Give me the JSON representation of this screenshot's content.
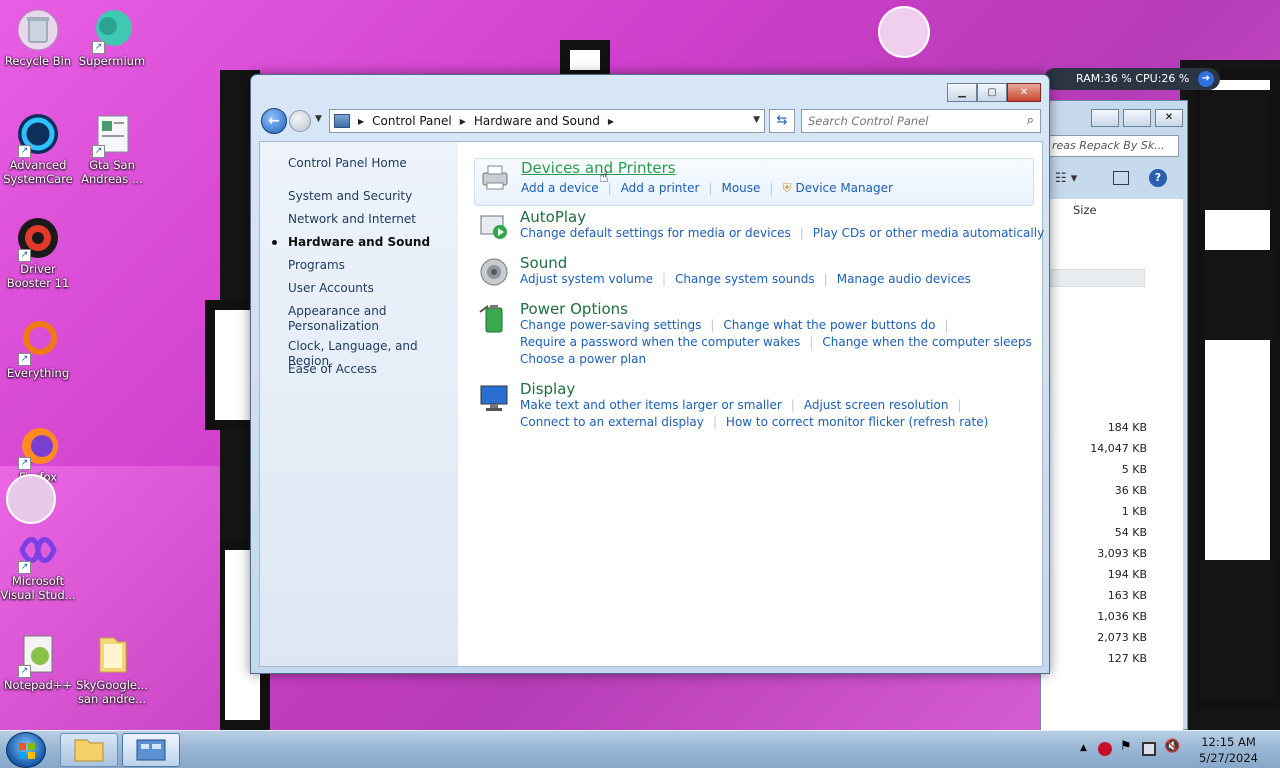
{
  "desktop": {
    "icons": [
      {
        "label": "Recycle Bin"
      },
      {
        "label": "Supermium"
      },
      {
        "label": "Advanced SystemCare"
      },
      {
        "label": "Gta San Andreas ..."
      },
      {
        "label": "Driver Booster 11"
      },
      {
        "label": "Everything"
      },
      {
        "label": "Firefox"
      },
      {
        "label": "Microsoft Visual Stud..."
      },
      {
        "label": "Notepad++"
      },
      {
        "label": "SkyGoogle... san andre..."
      }
    ]
  },
  "sysmon": {
    "text": "RAM:36 %  CPU:26 %"
  },
  "bg_window": {
    "search_placeholder": "reas Repack By Sk...",
    "column_size": "Size",
    "sizes": [
      "184 KB",
      "14,047 KB",
      "5 KB",
      "36 KB",
      "1 KB",
      "54 KB",
      "3,093 KB",
      "194 KB",
      "163 KB",
      "1,036 KB",
      "2,073 KB",
      "127 KB"
    ]
  },
  "window": {
    "breadcrumb": [
      "Control Panel",
      "Hardware and Sound"
    ],
    "search_placeholder": "Search Control Panel",
    "sidebar": {
      "home": "Control Panel Home",
      "items": [
        "System and Security",
        "Network and Internet",
        "Hardware and Sound",
        "Programs",
        "User Accounts",
        "Appearance and Personalization",
        "Clock, Language, and Region",
        "Ease of Access"
      ],
      "active_index": 2
    },
    "categories": [
      {
        "title": "Devices and Printers",
        "icon": "printer-icon",
        "lines": [
          [
            "Add a device",
            "Add a printer",
            "Mouse",
            "Device Manager"
          ]
        ]
      },
      {
        "title": "AutoPlay",
        "icon": "autoplay-icon",
        "lines": [
          [
            "Change default settings for media or devices",
            "Play CDs or other media automatically"
          ]
        ]
      },
      {
        "title": "Sound",
        "icon": "speaker-icon",
        "lines": [
          [
            "Adjust system volume",
            "Change system sounds",
            "Manage audio devices"
          ]
        ]
      },
      {
        "title": "Power Options",
        "icon": "battery-icon",
        "lines": [
          [
            "Change power-saving settings",
            "Change what the power buttons do"
          ],
          [
            "Require a password when the computer wakes",
            "Change when the computer sleeps"
          ],
          [
            "Choose a power plan"
          ]
        ]
      },
      {
        "title": "Display",
        "icon": "monitor-icon",
        "lines": [
          [
            "Make text and other items larger or smaller",
            "Adjust screen resolution"
          ],
          [
            "Connect to an external display",
            "How to correct monitor flicker (refresh rate)"
          ]
        ]
      }
    ]
  },
  "taskbar": {
    "time": "12:15 AM",
    "date": "5/27/2024"
  },
  "colors": {
    "link": "#1c5fb4",
    "category_title": "#1e6e3e",
    "wallpaper": "#d94fd6"
  }
}
